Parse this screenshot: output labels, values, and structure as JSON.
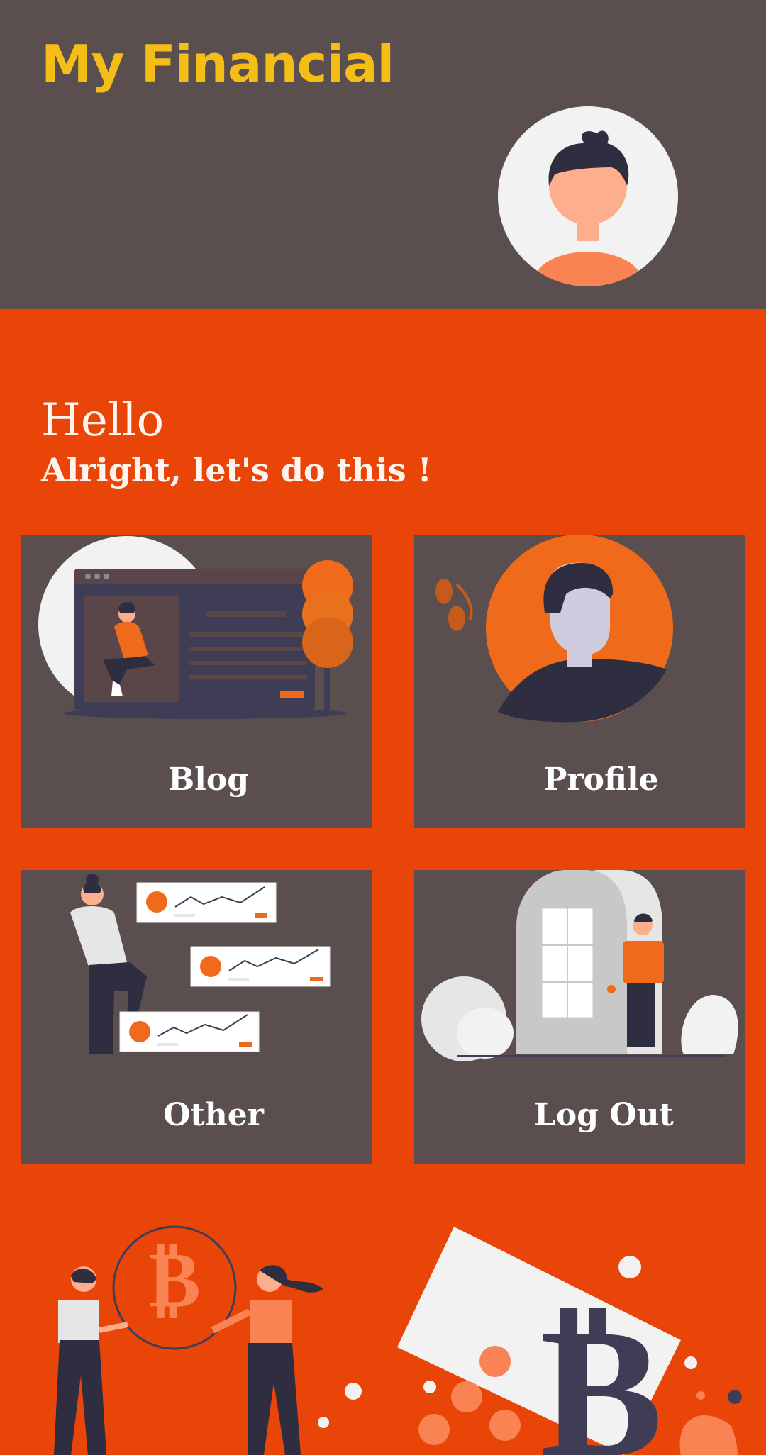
{
  "header": {
    "title": "My Financial",
    "avatar_icon": "user-avatar-icon"
  },
  "greeting": {
    "hello": "Hello",
    "subtitle": "Alright, let's do this !"
  },
  "menu": [
    {
      "label": "Blog",
      "icon": "blog-illustration-icon"
    },
    {
      "label": "Profile",
      "icon": "profile-illustration-icon"
    },
    {
      "label": "Other",
      "icon": "crypto-charts-illustration-icon"
    },
    {
      "label": "Log Out",
      "icon": "door-exit-illustration-icon"
    }
  ],
  "colors": {
    "background": "#EA4508",
    "panel": "#5B4E4F",
    "title": "#F5BE16",
    "accent": "#F06A1C"
  }
}
